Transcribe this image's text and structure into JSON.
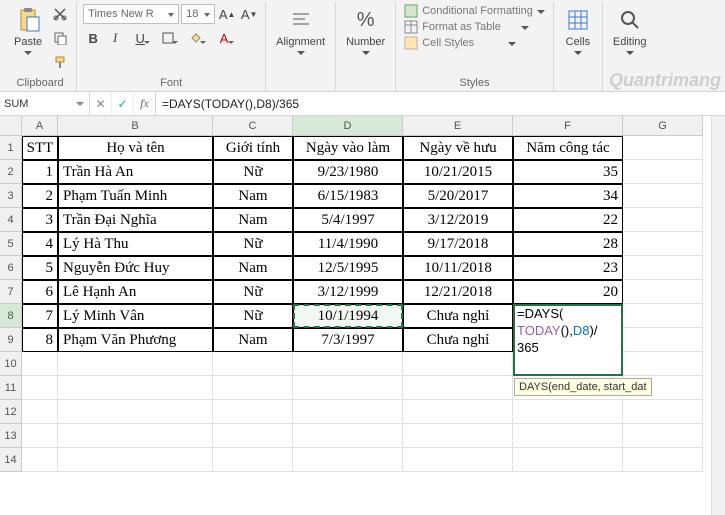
{
  "ribbon": {
    "clipboard": {
      "paste": "Paste",
      "label": "Clipboard"
    },
    "font": {
      "name": "Times New R",
      "size": "18",
      "label": "Font"
    },
    "alignment": {
      "label": "Alignment"
    },
    "number": {
      "label": "Number"
    },
    "styles": {
      "cond": "Conditional Formatting",
      "table": "Format as Table",
      "cellstyles": "Cell Styles",
      "label": "Styles"
    },
    "cells": {
      "label": "Cells"
    },
    "editing": {
      "label": "Editing"
    }
  },
  "formulaBar": {
    "nameBox": "SUM",
    "cancel": "✕",
    "enter": "✓",
    "fx": "fx",
    "formula": "=DAYS(TODAY(),D8)/365"
  },
  "tooltip": "DAYS(end_date, start_dat",
  "columns": [
    "A",
    "B",
    "C",
    "D",
    "E",
    "F",
    "G"
  ],
  "rowNums": [
    "1",
    "2",
    "3",
    "4",
    "5",
    "6",
    "7",
    "8",
    "9",
    "10",
    "11",
    "12",
    "13",
    "14"
  ],
  "activeRow": 8,
  "activeCol": "D",
  "headers": [
    "STT",
    "Họ và tên",
    "Giới tính",
    "Ngày vào làm",
    "Ngày về hưu",
    "Năm công tác"
  ],
  "data": [
    [
      "1",
      "Trần Hà An",
      "Nữ",
      "9/23/1980",
      "10/21/2015",
      "35"
    ],
    [
      "2",
      "Phạm Tuấn Minh",
      "Nam",
      "6/15/1983",
      "5/20/2017",
      "34"
    ],
    [
      "3",
      "Trần Đại Nghĩa",
      "Nam",
      "5/4/1997",
      "3/12/2019",
      "22"
    ],
    [
      "4",
      "Lý Hà Thu",
      "Nữ",
      "11/4/1990",
      "9/17/2018",
      "28"
    ],
    [
      "5",
      "Nguyễn Đức Huy",
      "Nam",
      "12/5/1995",
      "10/11/2018",
      "23"
    ],
    [
      "6",
      "Lê Hạnh An",
      "Nữ",
      "3/12/1999",
      "12/21/2018",
      "20"
    ],
    [
      "7",
      "Lý Minh Vân",
      "Nữ",
      "10/1/1994",
      "Chưa nghỉ",
      ""
    ],
    [
      "8",
      "Phạm Văn Phương",
      "Nam",
      "7/3/1997",
      "Chưa nghỉ",
      ""
    ]
  ],
  "editingFormula": {
    "line1a": "=DAYS(",
    "line2a": "TODAY",
    "line2b": "(),",
    "line2c": "D8",
    "line2d": ")/",
    "line3": "365"
  },
  "watermark": "Quantrimang"
}
